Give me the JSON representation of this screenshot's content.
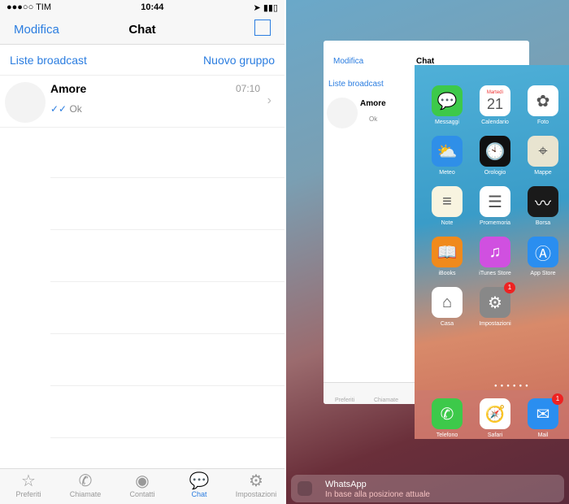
{
  "status": {
    "carrier": "●●●○○ TIM",
    "time": "10:44",
    "battery": "➤ ▮▮▯"
  },
  "nav": {
    "edit": "Modifica",
    "title": "Chat",
    "compose_icon": "compose-icon"
  },
  "links": {
    "broadcast": "Liste broadcast",
    "new_group": "Nuovo gruppo"
  },
  "chats": [
    {
      "name": "Amore",
      "time": "07:10",
      "ticks": "✓✓",
      "message": "Ok"
    }
  ],
  "tabs": [
    {
      "label": "Preferiti",
      "icon": "☆"
    },
    {
      "label": "Chiamate",
      "icon": "✆"
    },
    {
      "label": "Contatti",
      "icon": "◉"
    },
    {
      "label": "Chat",
      "icon": "💬",
      "active": true
    },
    {
      "label": "Impostazioni",
      "icon": "⚙"
    }
  ],
  "apps": [
    {
      "label": "Messaggi",
      "color": "#3dc94a",
      "glyph": "💬"
    },
    {
      "label": "Calendario",
      "color": "#ffffff",
      "glyph": "21",
      "sub": "Martedì"
    },
    {
      "label": "Foto",
      "color": "#ffffff",
      "glyph": "✿"
    },
    {
      "label": "Meteo",
      "color": "#2f8fe8",
      "glyph": "⛅"
    },
    {
      "label": "Orologio",
      "color": "#111111",
      "glyph": "🕙"
    },
    {
      "label": "Mappe",
      "color": "#e8e4d0",
      "glyph": "⌖"
    },
    {
      "label": "Note",
      "color": "#f8f4e0",
      "glyph": "≡"
    },
    {
      "label": "Promemoria",
      "color": "#ffffff",
      "glyph": "☰"
    },
    {
      "label": "Borsa",
      "color": "#1a1a1a",
      "glyph": "〰"
    },
    {
      "label": "iBooks",
      "color": "#f08a1c",
      "glyph": "📖"
    },
    {
      "label": "iTunes Store",
      "color": "#d050e0",
      "glyph": "♫"
    },
    {
      "label": "App Store",
      "color": "#2a8ef0",
      "glyph": "Ⓐ"
    },
    {
      "label": "Casa",
      "color": "#ffffff",
      "glyph": "⌂"
    },
    {
      "label": "Impostazioni",
      "color": "#888888",
      "glyph": "⚙",
      "badge": "1"
    }
  ],
  "dock": [
    {
      "label": "Telefono",
      "color": "#3dc94a",
      "glyph": "✆"
    },
    {
      "label": "Safari",
      "color": "#ffffff",
      "glyph": "🧭"
    },
    {
      "label": "Mail",
      "color": "#2a8ef0",
      "glyph": "✉",
      "badge": "1"
    }
  ],
  "notification": {
    "app": "WhatsApp",
    "text": "In base alla posizione attuale"
  }
}
